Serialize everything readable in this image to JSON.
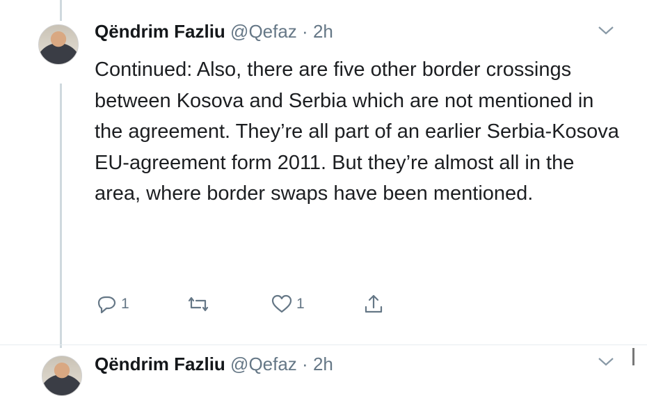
{
  "tweets": [
    {
      "name": "Qëndrim Fazliu",
      "handle": "@Qefaz",
      "separator": "·",
      "time": "2h",
      "text": "Continued: Also, there are five other border crossings between Kosova and Serbia which are not mentioned in the agreement. They’re all part of an earlier Serbia-Kosova EU-agreement form 2011. But they’re almost all in the area, where border swaps have been mentioned.",
      "actions": {
        "reply_count": "1",
        "retweet_count": "",
        "like_count": "1"
      }
    },
    {
      "name": "Qëndrim Fazliu",
      "handle": "@Qefaz",
      "separator": "·",
      "time": "2h"
    }
  ],
  "icons": [
    "reply-icon",
    "retweet-icon",
    "like-icon",
    "share-icon",
    "chevron-down-icon"
  ],
  "colors": {
    "text": "#14171a",
    "muted": "#657786",
    "thread_line": "#cfd9de"
  }
}
